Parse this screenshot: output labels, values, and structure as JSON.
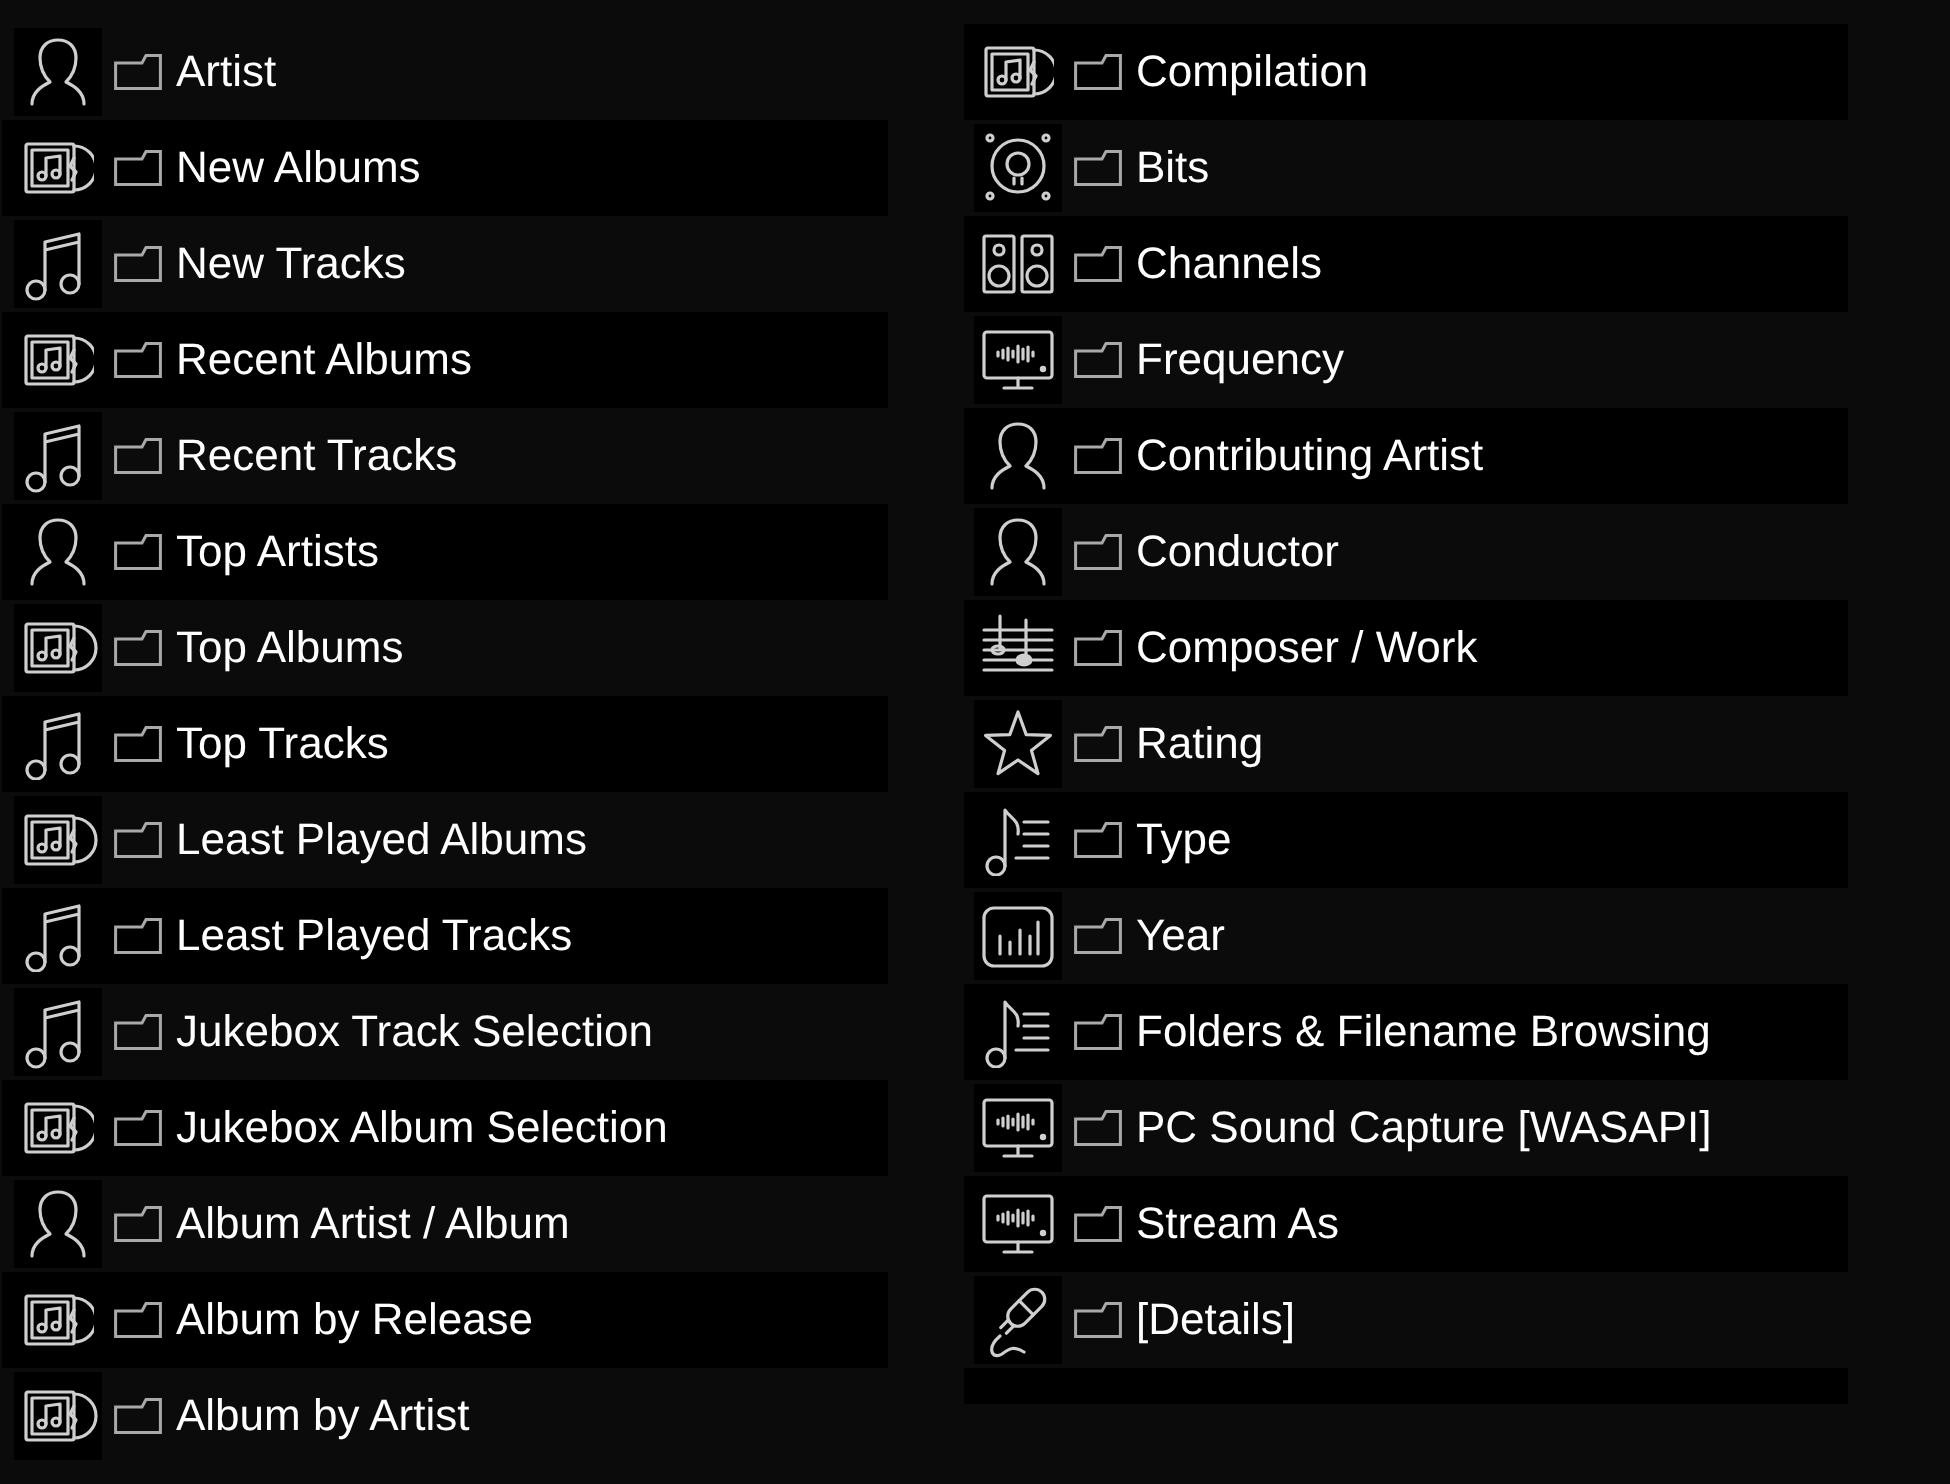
{
  "columns": [
    {
      "items": [
        {
          "label": "Artist",
          "kind": "artist"
        },
        {
          "label": "New Albums",
          "kind": "album"
        },
        {
          "label": "New Tracks",
          "kind": "track"
        },
        {
          "label": "Recent Albums",
          "kind": "album"
        },
        {
          "label": "Recent Tracks",
          "kind": "track"
        },
        {
          "label": "Top Artists",
          "kind": "artist"
        },
        {
          "label": "Top Albums",
          "kind": "album"
        },
        {
          "label": "Top Tracks",
          "kind": "track"
        },
        {
          "label": "Least Played Albums",
          "kind": "album"
        },
        {
          "label": "Least Played Tracks",
          "kind": "track"
        },
        {
          "label": "Jukebox Track Selection",
          "kind": "track"
        },
        {
          "label": "Jukebox Album Selection",
          "kind": "album"
        },
        {
          "label": "Album Artist / Album",
          "kind": "artist"
        },
        {
          "label": "Album by Release",
          "kind": "album"
        },
        {
          "label": "Album by Artist",
          "kind": "album"
        }
      ]
    },
    {
      "items": [
        {
          "label": "Compilation",
          "kind": "album"
        },
        {
          "label": "Bits",
          "kind": "speaker"
        },
        {
          "label": "Channels",
          "kind": "stereo"
        },
        {
          "label": "Frequency",
          "kind": "monitor"
        },
        {
          "label": "Contributing Artist",
          "kind": "artist"
        },
        {
          "label": "Conductor",
          "kind": "artist"
        },
        {
          "label": "Composer / Work",
          "kind": "score"
        },
        {
          "label": "Rating",
          "kind": "star"
        },
        {
          "label": "Type",
          "kind": "notes"
        },
        {
          "label": "Year",
          "kind": "chart"
        },
        {
          "label": "Folders & Filename Browsing",
          "kind": "notes"
        },
        {
          "label": "PC Sound Capture [WASAPI]",
          "kind": "monitor"
        },
        {
          "label": "Stream As",
          "kind": "monitor"
        },
        {
          "label": "[Details]",
          "kind": "plug"
        }
      ]
    }
  ]
}
